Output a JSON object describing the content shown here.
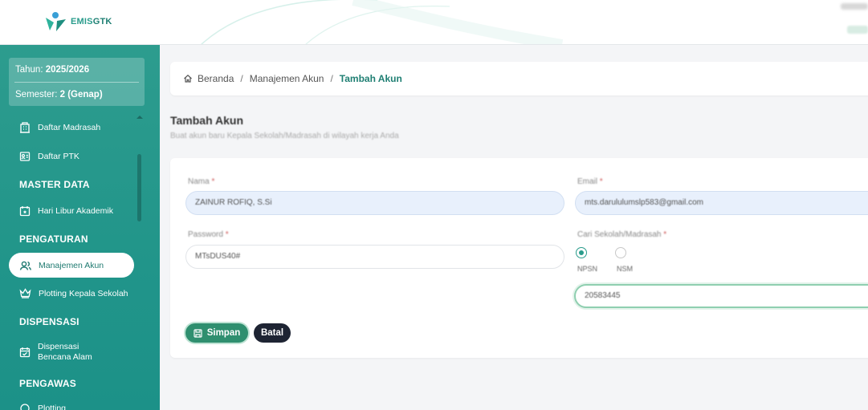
{
  "app": {
    "brand_plain": "EMIS",
    "brand_bold": "GTK"
  },
  "sidebar": {
    "year_label": "Tahun: ",
    "year_value": "2025/2026",
    "semester_label": "Semester: ",
    "semester_value": "2 (Genap)",
    "items": [
      {
        "label": "Daftar Madrasah",
        "icon": "building-icon"
      },
      {
        "label": "Daftar PTK",
        "icon": "id-card-icon"
      },
      {
        "label": "Hari Libur Akademik",
        "icon": "calendar-star-icon"
      },
      {
        "label": "Manajemen Akun",
        "icon": "users-icon",
        "active": true
      },
      {
        "label": "Plotting Kepala Sekolah",
        "icon": "crown-icon"
      },
      {
        "label_line1": "Dispensasi",
        "label_line2": "Bencana Alam",
        "icon": "calendar-check-icon"
      },
      {
        "label": "Plotting",
        "icon": "pin-icon"
      }
    ],
    "sections": [
      "MASTER DATA",
      "PENGATURAN",
      "DISPENSASI",
      "PENGAWAS"
    ]
  },
  "breadcrumb": {
    "home": "Beranda",
    "separator": "/",
    "parent": "Manajemen Akun",
    "current": "Tambah Akun"
  },
  "page": {
    "title": "Tambah Akun",
    "subtitle": "Buat akun baru Kepala Sekolah/Madrasah di wilayah kerja Anda"
  },
  "form": {
    "name_label": "Nama",
    "name_value": "ZAINUR ROFIQ, S.Si",
    "email_label": "Email",
    "email_value": "mts.darululumslp583@gmail.com",
    "password_label": "Password",
    "password_value": "MTsDUS40#",
    "school_label": "Cari Sekolah/Madrasah",
    "radio_npsn": "NPSN",
    "radio_nsm": "NSM",
    "school_value": "20583445",
    "required_mark": "*",
    "save_label": "Simpan",
    "cancel_label": "Batal"
  },
  "colors": {
    "primary": "#2a9c8c",
    "sidebar": "#21958a",
    "save_button": "#2f8f6f",
    "cancel_button": "#1e2433",
    "active_text": "#1f7a70"
  }
}
